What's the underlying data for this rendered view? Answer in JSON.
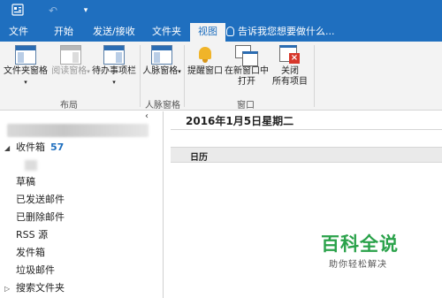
{
  "quick_access": {
    "app_icon": "outlook-app-icon",
    "undo_icon": "undo-icon",
    "customize_icon": "customize-dropdown-icon"
  },
  "menu": {
    "tabs": [
      "文件",
      "开始",
      "发送/接收",
      "文件夹",
      "视图"
    ],
    "active_tab": "视图",
    "tell_me": "告诉我您想要做什么..."
  },
  "ribbon": {
    "layout": {
      "group_label": "布局",
      "folder_pane": "文件夹窗格",
      "reading_pane": "阅读窗格",
      "todo_bar": "待办事项栏"
    },
    "people": {
      "group_label": "人脉窗格",
      "people_pane": "人脉窗格"
    },
    "window": {
      "group_label": "窗口",
      "reminders_window": "提醒窗口",
      "open_new_window_line1": "在新窗口中",
      "open_new_window_line2": "打开",
      "close_all_line1": "关闭",
      "close_all_line2": "所有项目"
    }
  },
  "folders": {
    "inbox_label": "收件箱",
    "inbox_count": "57",
    "items": [
      "草稿",
      "已发送邮件",
      "已删除邮件",
      "RSS 源",
      "发件箱",
      "垃圾邮件"
    ],
    "search_folders": "搜索文件夹"
  },
  "main": {
    "date_header": "2016年1月5日星期二",
    "calendar_label": "日历"
  },
  "watermark": {
    "title": "百科全说",
    "subtitle": "助你轻松解决"
  },
  "colors": {
    "accent": "#1f6fbf",
    "watermark": "#2aa24a"
  }
}
